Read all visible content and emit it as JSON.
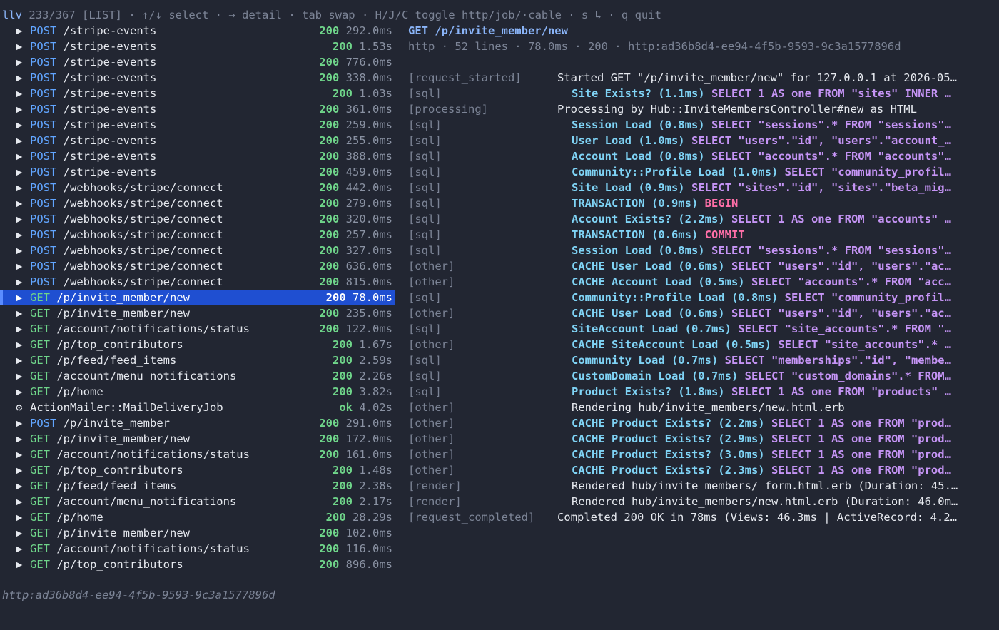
{
  "header": {
    "app": "llv",
    "position": "233/367",
    "mode": "[LIST]",
    "hints": "· ↑/↓ select · → detail · tab swap · H/J/C toggle http/job/·cable · s ↳ · q quit"
  },
  "colors": {
    "background": "#222632",
    "selected_row": "#1f4fd1",
    "post": "#61a5ff",
    "get": "#6fd58a",
    "status": "#6fd58a",
    "sql_name": "#7fd3f5",
    "sql_text": "#c594f5",
    "sql_keyword": "#ff6fa8"
  },
  "requests": [
    {
      "icon": "▶",
      "method": "POST",
      "path": "/stripe-events",
      "status": "200",
      "duration": "292.0ms"
    },
    {
      "icon": "▶",
      "method": "POST",
      "path": "/stripe-events",
      "status": "200",
      "duration": "1.53s"
    },
    {
      "icon": "▶",
      "method": "POST",
      "path": "/stripe-events",
      "status": "200",
      "duration": "776.0ms"
    },
    {
      "icon": "▶",
      "method": "POST",
      "path": "/stripe-events",
      "status": "200",
      "duration": "338.0ms"
    },
    {
      "icon": "▶",
      "method": "POST",
      "path": "/stripe-events",
      "status": "200",
      "duration": "1.03s"
    },
    {
      "icon": "▶",
      "method": "POST",
      "path": "/stripe-events",
      "status": "200",
      "duration": "361.0ms"
    },
    {
      "icon": "▶",
      "method": "POST",
      "path": "/stripe-events",
      "status": "200",
      "duration": "259.0ms"
    },
    {
      "icon": "▶",
      "method": "POST",
      "path": "/stripe-events",
      "status": "200",
      "duration": "255.0ms"
    },
    {
      "icon": "▶",
      "method": "POST",
      "path": "/stripe-events",
      "status": "200",
      "duration": "388.0ms"
    },
    {
      "icon": "▶",
      "method": "POST",
      "path": "/stripe-events",
      "status": "200",
      "duration": "459.0ms"
    },
    {
      "icon": "▶",
      "method": "POST",
      "path": "/webhooks/stripe/connect",
      "status": "200",
      "duration": "442.0ms"
    },
    {
      "icon": "▶",
      "method": "POST",
      "path": "/webhooks/stripe/connect",
      "status": "200",
      "duration": "279.0ms"
    },
    {
      "icon": "▶",
      "method": "POST",
      "path": "/webhooks/stripe/connect",
      "status": "200",
      "duration": "320.0ms"
    },
    {
      "icon": "▶",
      "method": "POST",
      "path": "/webhooks/stripe/connect",
      "status": "200",
      "duration": "257.0ms"
    },
    {
      "icon": "▶",
      "method": "POST",
      "path": "/webhooks/stripe/connect",
      "status": "200",
      "duration": "327.0ms"
    },
    {
      "icon": "▶",
      "method": "POST",
      "path": "/webhooks/stripe/connect",
      "status": "200",
      "duration": "636.0ms"
    },
    {
      "icon": "▶",
      "method": "POST",
      "path": "/webhooks/stripe/connect",
      "status": "200",
      "duration": "815.0ms"
    },
    {
      "icon": "▶",
      "method": "GET",
      "path": "/p/invite_member/new",
      "status": "200",
      "duration": "78.0ms",
      "selected": true
    },
    {
      "icon": "▶",
      "method": "GET",
      "path": "/p/invite_member/new",
      "status": "200",
      "duration": "235.0ms"
    },
    {
      "icon": "▶",
      "method": "GET",
      "path": "/account/notifications/status",
      "status": "200",
      "duration": "122.0ms"
    },
    {
      "icon": "▶",
      "method": "GET",
      "path": "/p/top_contributors",
      "status": "200",
      "duration": "1.67s"
    },
    {
      "icon": "▶",
      "method": "GET",
      "path": "/p/feed/feed_items",
      "status": "200",
      "duration": "2.59s"
    },
    {
      "icon": "▶",
      "method": "GET",
      "path": "/account/menu_notifications",
      "status": "200",
      "duration": "2.26s"
    },
    {
      "icon": "▶",
      "method": "GET",
      "path": "/p/home",
      "status": "200",
      "duration": "3.82s"
    },
    {
      "icon": "⚙",
      "method": "JOB",
      "path": "ActionMailer::MailDeliveryJob",
      "status": "ok",
      "duration": "4.02s"
    },
    {
      "icon": "▶",
      "method": "POST",
      "path": "/p/invite_member",
      "status": "200",
      "duration": "291.0ms"
    },
    {
      "icon": "▶",
      "method": "GET",
      "path": "/p/invite_member/new",
      "status": "200",
      "duration": "172.0ms"
    },
    {
      "icon": "▶",
      "method": "GET",
      "path": "/account/notifications/status",
      "status": "200",
      "duration": "161.0ms"
    },
    {
      "icon": "▶",
      "method": "GET",
      "path": "/p/top_contributors",
      "status": "200",
      "duration": "1.48s"
    },
    {
      "icon": "▶",
      "method": "GET",
      "path": "/p/feed/feed_items",
      "status": "200",
      "duration": "2.38s"
    },
    {
      "icon": "▶",
      "method": "GET",
      "path": "/account/menu_notifications",
      "status": "200",
      "duration": "2.17s"
    },
    {
      "icon": "▶",
      "method": "GET",
      "path": "/p/home",
      "status": "200",
      "duration": "28.29s"
    },
    {
      "icon": "▶",
      "method": "GET",
      "path": "/p/invite_member/new",
      "status": "200",
      "duration": "102.0ms"
    },
    {
      "icon": "▶",
      "method": "GET",
      "path": "/account/notifications/status",
      "status": "200",
      "duration": "116.0ms"
    },
    {
      "icon": "▶",
      "method": "GET",
      "path": "/p/top_contributors",
      "status": "200",
      "duration": "896.0ms"
    }
  ],
  "detail": {
    "title": "GET /p/invite_member/new",
    "meta": "http · 52 lines · 78.0ms · 200 · http:ad36b8d4-ee94-4f5b-9593-9c3a1577896d",
    "lines": [
      {
        "tag": "[request_started]",
        "text": "Started GET \"/p/invite_member/new\" for 127.0.0.1 at 2026-05…"
      },
      {
        "tag": "[sql]",
        "name": "Site Exists? (1.1ms)",
        "sql": "SELECT 1 AS one FROM \"sites\" INNER …"
      },
      {
        "tag": "[processing]",
        "text": "Processing by Hub::InviteMembersController#new as HTML"
      },
      {
        "tag": "[sql]",
        "name": "Session Load (0.8ms)",
        "sql": "SELECT \"sessions\".* FROM \"sessions\"…"
      },
      {
        "tag": "[sql]",
        "name": "User Load (1.0ms)",
        "sql": "SELECT \"users\".\"id\", \"users\".\"account_…"
      },
      {
        "tag": "[sql]",
        "name": "Account Load (0.8ms)",
        "sql": "SELECT \"accounts\".* FROM \"accounts\"…"
      },
      {
        "tag": "[sql]",
        "name": "Community::Profile Load (1.0ms)",
        "sql": "SELECT \"community_profil…"
      },
      {
        "tag": "[sql]",
        "name": "Site Load (0.9ms)",
        "sql": "SELECT \"sites\".\"id\", \"sites\".\"beta_mig…"
      },
      {
        "tag": "[sql]",
        "name": "TRANSACTION (0.9ms)",
        "kw": "BEGIN"
      },
      {
        "tag": "[sql]",
        "name": "Account Exists? (2.2ms)",
        "sql": "SELECT 1 AS one FROM \"accounts\" …"
      },
      {
        "tag": "[sql]",
        "name": "TRANSACTION (0.6ms)",
        "kw": "COMMIT"
      },
      {
        "tag": "[sql]",
        "name": "Session Load (0.8ms)",
        "sql": "SELECT \"sessions\".* FROM \"sessions\"…"
      },
      {
        "tag": "[other]",
        "name": "CACHE User Load (0.6ms)",
        "sql": "SELECT \"users\".\"id\", \"users\".\"ac…"
      },
      {
        "tag": "[other]",
        "name": "CACHE Account Load (0.5ms)",
        "sql": "SELECT \"accounts\".* FROM \"acc…"
      },
      {
        "tag": "[sql]",
        "name": "Community::Profile Load (0.8ms)",
        "sql": "SELECT \"community_profil…"
      },
      {
        "tag": "[other]",
        "name": "CACHE User Load (0.6ms)",
        "sql": "SELECT \"users\".\"id\", \"users\".\"ac…"
      },
      {
        "tag": "[sql]",
        "name": "SiteAccount Load (0.7ms)",
        "sql": "SELECT \"site_accounts\".* FROM \"…"
      },
      {
        "tag": "[other]",
        "name": "CACHE SiteAccount Load (0.5ms)",
        "sql": "SELECT \"site_accounts\".* …"
      },
      {
        "tag": "[sql]",
        "name": "Community Load (0.7ms)",
        "sql": "SELECT \"memberships\".\"id\", \"membe…"
      },
      {
        "tag": "[sql]",
        "name": "CustomDomain Load (0.7ms)",
        "sql": "SELECT \"custom_domains\".* FROM…"
      },
      {
        "tag": "[sql]",
        "name": "Product Exists? (1.8ms)",
        "sql": "SELECT 1 AS one FROM \"products\" …"
      },
      {
        "tag": "[other]",
        "text": "Rendering hub/invite_members/new.html.erb",
        "indent": true
      },
      {
        "tag": "[other]",
        "name": "CACHE Product Exists? (2.2ms)",
        "sql": "SELECT 1 AS one FROM \"prod…"
      },
      {
        "tag": "[other]",
        "name": "CACHE Product Exists? (2.9ms)",
        "sql": "SELECT 1 AS one FROM \"prod…"
      },
      {
        "tag": "[other]",
        "name": "CACHE Product Exists? (3.0ms)",
        "sql": "SELECT 1 AS one FROM \"prod…"
      },
      {
        "tag": "[other]",
        "name": "CACHE Product Exists? (2.3ms)",
        "sql": "SELECT 1 AS one FROM \"prod…"
      },
      {
        "tag": "[render]",
        "text": "Rendered hub/invite_members/_form.html.erb (Duration: 45.…",
        "indent": true
      },
      {
        "tag": "[render]",
        "text": "Rendered hub/invite_members/new.html.erb (Duration: 46.0m…",
        "indent": true
      },
      {
        "tag": "[request_completed]",
        "text": "Completed 200 OK in 78ms (Views: 46.3ms | ActiveRecord: 4.2…"
      }
    ]
  },
  "footer": {
    "id": "http:ad36b8d4-ee94-4f5b-9593-9c3a1577896d"
  }
}
